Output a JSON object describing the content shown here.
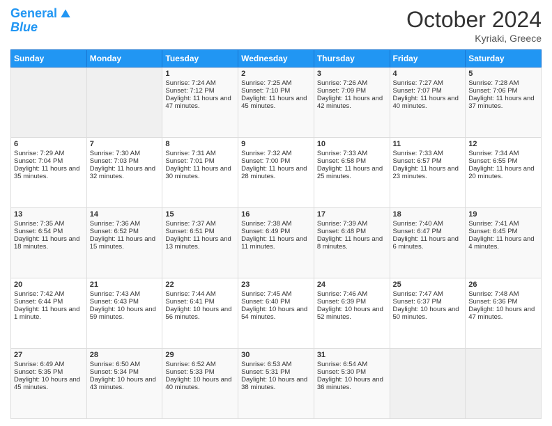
{
  "header": {
    "logo_line1": "General",
    "logo_line2": "Blue",
    "month": "October 2024",
    "location": "Kyriaki, Greece"
  },
  "weekdays": [
    "Sunday",
    "Monday",
    "Tuesday",
    "Wednesday",
    "Thursday",
    "Friday",
    "Saturday"
  ],
  "rows": [
    [
      {
        "day": "",
        "content": ""
      },
      {
        "day": "",
        "content": ""
      },
      {
        "day": "1",
        "content": "Sunrise: 7:24 AM\nSunset: 7:12 PM\nDaylight: 11 hours and 47 minutes."
      },
      {
        "day": "2",
        "content": "Sunrise: 7:25 AM\nSunset: 7:10 PM\nDaylight: 11 hours and 45 minutes."
      },
      {
        "day": "3",
        "content": "Sunrise: 7:26 AM\nSunset: 7:09 PM\nDaylight: 11 hours and 42 minutes."
      },
      {
        "day": "4",
        "content": "Sunrise: 7:27 AM\nSunset: 7:07 PM\nDaylight: 11 hours and 40 minutes."
      },
      {
        "day": "5",
        "content": "Sunrise: 7:28 AM\nSunset: 7:06 PM\nDaylight: 11 hours and 37 minutes."
      }
    ],
    [
      {
        "day": "6",
        "content": "Sunrise: 7:29 AM\nSunset: 7:04 PM\nDaylight: 11 hours and 35 minutes."
      },
      {
        "day": "7",
        "content": "Sunrise: 7:30 AM\nSunset: 7:03 PM\nDaylight: 11 hours and 32 minutes."
      },
      {
        "day": "8",
        "content": "Sunrise: 7:31 AM\nSunset: 7:01 PM\nDaylight: 11 hours and 30 minutes."
      },
      {
        "day": "9",
        "content": "Sunrise: 7:32 AM\nSunset: 7:00 PM\nDaylight: 11 hours and 28 minutes."
      },
      {
        "day": "10",
        "content": "Sunrise: 7:33 AM\nSunset: 6:58 PM\nDaylight: 11 hours and 25 minutes."
      },
      {
        "day": "11",
        "content": "Sunrise: 7:33 AM\nSunset: 6:57 PM\nDaylight: 11 hours and 23 minutes."
      },
      {
        "day": "12",
        "content": "Sunrise: 7:34 AM\nSunset: 6:55 PM\nDaylight: 11 hours and 20 minutes."
      }
    ],
    [
      {
        "day": "13",
        "content": "Sunrise: 7:35 AM\nSunset: 6:54 PM\nDaylight: 11 hours and 18 minutes."
      },
      {
        "day": "14",
        "content": "Sunrise: 7:36 AM\nSunset: 6:52 PM\nDaylight: 11 hours and 15 minutes."
      },
      {
        "day": "15",
        "content": "Sunrise: 7:37 AM\nSunset: 6:51 PM\nDaylight: 11 hours and 13 minutes."
      },
      {
        "day": "16",
        "content": "Sunrise: 7:38 AM\nSunset: 6:49 PM\nDaylight: 11 hours and 11 minutes."
      },
      {
        "day": "17",
        "content": "Sunrise: 7:39 AM\nSunset: 6:48 PM\nDaylight: 11 hours and 8 minutes."
      },
      {
        "day": "18",
        "content": "Sunrise: 7:40 AM\nSunset: 6:47 PM\nDaylight: 11 hours and 6 minutes."
      },
      {
        "day": "19",
        "content": "Sunrise: 7:41 AM\nSunset: 6:45 PM\nDaylight: 11 hours and 4 minutes."
      }
    ],
    [
      {
        "day": "20",
        "content": "Sunrise: 7:42 AM\nSunset: 6:44 PM\nDaylight: 11 hours and 1 minute."
      },
      {
        "day": "21",
        "content": "Sunrise: 7:43 AM\nSunset: 6:43 PM\nDaylight: 10 hours and 59 minutes."
      },
      {
        "day": "22",
        "content": "Sunrise: 7:44 AM\nSunset: 6:41 PM\nDaylight: 10 hours and 56 minutes."
      },
      {
        "day": "23",
        "content": "Sunrise: 7:45 AM\nSunset: 6:40 PM\nDaylight: 10 hours and 54 minutes."
      },
      {
        "day": "24",
        "content": "Sunrise: 7:46 AM\nSunset: 6:39 PM\nDaylight: 10 hours and 52 minutes."
      },
      {
        "day": "25",
        "content": "Sunrise: 7:47 AM\nSunset: 6:37 PM\nDaylight: 10 hours and 50 minutes."
      },
      {
        "day": "26",
        "content": "Sunrise: 7:48 AM\nSunset: 6:36 PM\nDaylight: 10 hours and 47 minutes."
      }
    ],
    [
      {
        "day": "27",
        "content": "Sunrise: 6:49 AM\nSunset: 5:35 PM\nDaylight: 10 hours and 45 minutes."
      },
      {
        "day": "28",
        "content": "Sunrise: 6:50 AM\nSunset: 5:34 PM\nDaylight: 10 hours and 43 minutes."
      },
      {
        "day": "29",
        "content": "Sunrise: 6:52 AM\nSunset: 5:33 PM\nDaylight: 10 hours and 40 minutes."
      },
      {
        "day": "30",
        "content": "Sunrise: 6:53 AM\nSunset: 5:31 PM\nDaylight: 10 hours and 38 minutes."
      },
      {
        "day": "31",
        "content": "Sunrise: 6:54 AM\nSunset: 5:30 PM\nDaylight: 10 hours and 36 minutes."
      },
      {
        "day": "",
        "content": ""
      },
      {
        "day": "",
        "content": ""
      }
    ]
  ]
}
